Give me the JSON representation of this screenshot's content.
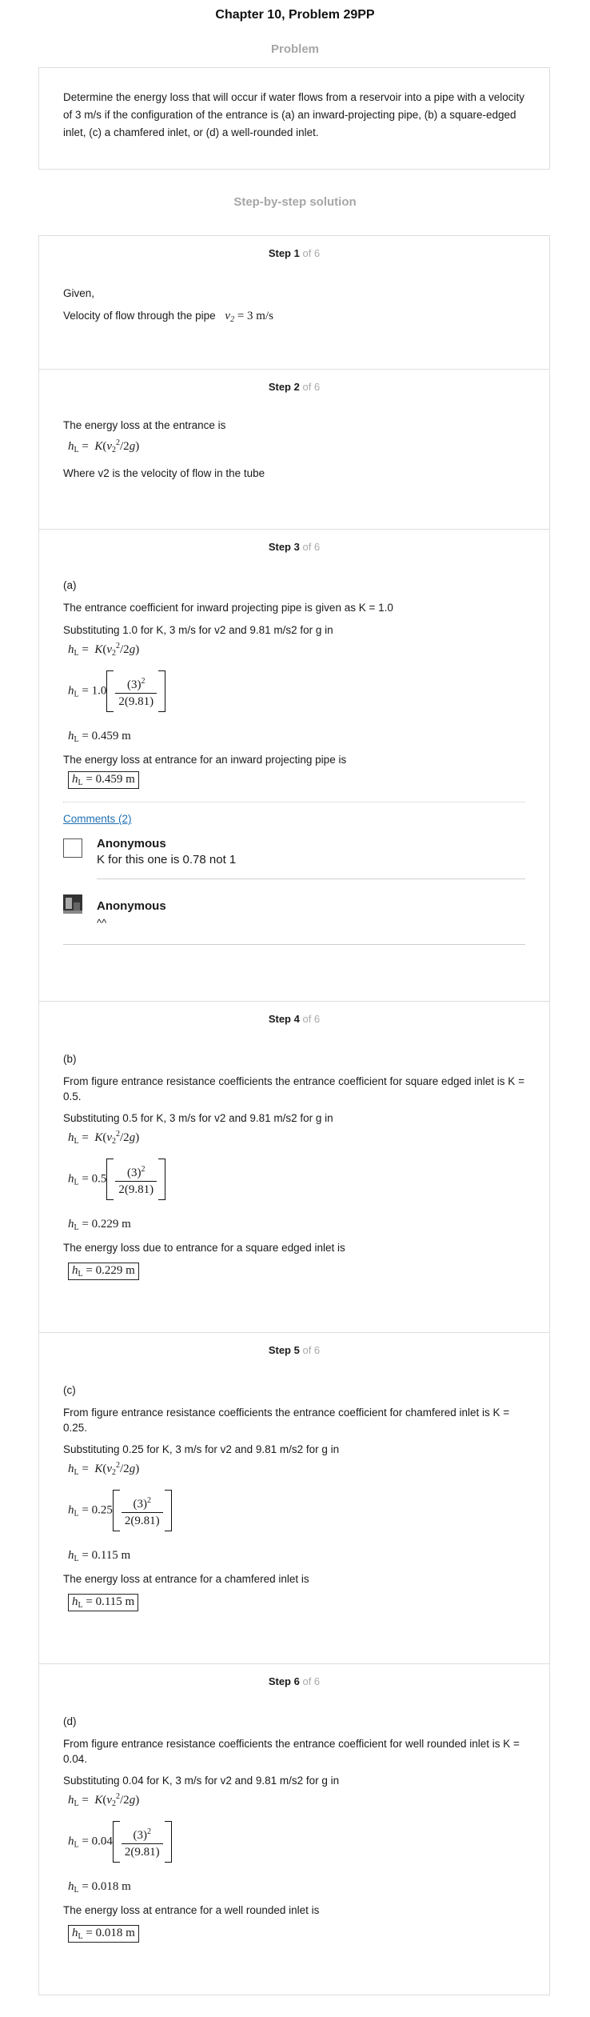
{
  "title": "Chapter 10, Problem 29PP",
  "problem_heading": "Problem",
  "problem_text": "Determine the energy loss that will occur if water flows from a reservoir into a pipe with a velocity of 3 m/s if the configuration of the entrance is (a) an inward-projecting pipe, (b) a square-edged inlet, (c) a chamfered inlet, or (d) a well-rounded inlet.",
  "solution_heading": "Step-by-step solution",
  "of_total": "of 6",
  "steps": {
    "s1": {
      "label": "Step 1",
      "given": "Given,",
      "velocity_label": "Velocity of flow through the pipe",
      "velocity_eq_v": "v",
      "velocity_eq_sub": "2",
      "velocity_eq_rest": " = 3 m/s"
    },
    "s2": {
      "label": "Step 2",
      "intro": "The energy loss at the entrance is",
      "eq": "h",
      "eq_sub": "L",
      "eq_rhs_a": " =  K",
      "eq_rhs_b": "(v",
      "eq_rhs_sub": "2",
      "eq_rhs_sup": "2",
      "eq_rhs_c": "/2g)",
      "where": "Where v2 is the velocity of flow in the tube"
    },
    "s3": {
      "label": "Step 3",
      "part": "(a)",
      "coef": "The entrance coefficient for inward projecting pipe is given as K = 1.0",
      "subst": "Substituting 1.0 for K, 3 m/s for v2 and 9.81 m/s2 for g in",
      "k": "1.0",
      "result": "0.459 m",
      "conclusion": "The energy loss at entrance for an inward projecting pipe is"
    },
    "comments": {
      "link": "Comments (2)",
      "c1_name": "Anonymous",
      "c1_text": "K for this one is 0.78 not 1",
      "c2_name": "Anonymous",
      "c2_text": "^^"
    },
    "s4": {
      "label": "Step 4",
      "part": "(b)",
      "coef": "From figure entrance resistance coefficients the entrance coefficient for square edged inlet is K = 0.5.",
      "subst": "Substituting 0.5 for K, 3 m/s for v2 and 9.81 m/s2 for g in",
      "k": "0.5",
      "result": "0.229 m",
      "conclusion": "The energy loss due to entrance for a square edged inlet is"
    },
    "s5": {
      "label": "Step 5",
      "part": "(c)",
      "coef": "From figure entrance resistance coefficients the entrance coefficient for chamfered inlet is K = 0.25.",
      "subst": "Substituting 0.25 for K, 3 m/s for v2 and 9.81 m/s2 for g in",
      "k": "0.25",
      "result": "0.115 m",
      "conclusion": "The energy loss at entrance for a chamfered inlet is"
    },
    "s6": {
      "label": "Step 6",
      "part": "(d)",
      "coef": "From figure entrance resistance coefficients the entrance coefficient for well rounded inlet is K = 0.04.",
      "subst": "Substituting 0.04 for K, 3 m/s for v2 and 9.81 m/s2 for g in",
      "k": "0.04",
      "result": "0.018 m",
      "conclusion": "The energy loss at entrance for a well rounded inlet is"
    }
  },
  "formula": {
    "h": "h",
    "L": "L",
    "eq_sign": " = ",
    "K": "K",
    "num": "(3)",
    "num_sup": "2",
    "den": "2(9.81)"
  }
}
